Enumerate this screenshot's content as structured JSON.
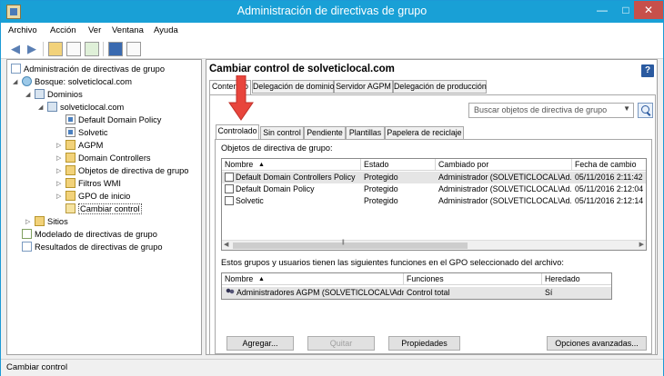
{
  "window": {
    "title": "Administración de directivas de grupo"
  },
  "menu": [
    {
      "label": "Archivo"
    },
    {
      "label": "Acción"
    },
    {
      "label": "Ver"
    },
    {
      "label": "Ventana"
    },
    {
      "label": "Ayuda"
    }
  ],
  "tree": {
    "root": "Administración de directivas de grupo",
    "forest": "Bosque: solveticlocal.com",
    "domains": "Dominios",
    "domain": "solveticlocal.com",
    "items": [
      "Default Domain Policy",
      "Solvetic",
      "AGPM",
      "Domain Controllers",
      "Objetos de directiva de grupo",
      "Filtros WMI",
      "GPO de inicio",
      "Cambiar control"
    ],
    "sites": "Sitios",
    "modeling": "Modelado de directivas de grupo",
    "results": "Resultados de directivas de grupo"
  },
  "main": {
    "title": "Cambiar control de solveticlocal.com",
    "tabs": [
      "Contenido",
      "Delegación de dominio",
      "Servidor AGPM",
      "Delegación de producción"
    ],
    "search_placeholder": "Buscar objetos de directiva de grupo",
    "subtabs": [
      "Controlado",
      "Sin control",
      "Pendiente",
      "Plantillas",
      "Papelera de reciclaje"
    ],
    "gpo_label": "Objetos de directiva de grupo:",
    "gpo_columns": [
      "Nombre",
      "Estado",
      "Cambiado por",
      "Fecha de cambio"
    ],
    "gpo_rows": [
      {
        "name": "Default Domain Controllers Policy",
        "state": "Protegido",
        "by": "Administrador (SOLVETICLOCAL\\Ad...",
        "date": "05/11/2016 2:11:42"
      },
      {
        "name": "Default Domain Policy",
        "state": "Protegido",
        "by": "Administrador (SOLVETICLOCAL\\Ad...",
        "date": "05/11/2016 2:12:04"
      },
      {
        "name": "Solvetic",
        "state": "Protegido",
        "by": "Administrador (SOLVETICLOCAL\\Ad...",
        "date": "05/11/2016 2:12:14"
      }
    ],
    "groups_label": "Estos grupos y usuarios tienen las siguientes funciones en el GPO seleccionado del archivo:",
    "group_columns": [
      "Nombre",
      "Funciones",
      "Heredado"
    ],
    "group_rows": [
      {
        "name": "Administradores AGPM (SOLVETICLOCAL\\Admi...",
        "role": "Control total",
        "inherited": "Sí"
      }
    ],
    "buttons": {
      "add": "Agregar...",
      "remove": "Quitar",
      "properties": "Propiedades",
      "advanced": "Opciones avanzadas..."
    }
  },
  "status": {
    "text": "Cambiar control"
  }
}
